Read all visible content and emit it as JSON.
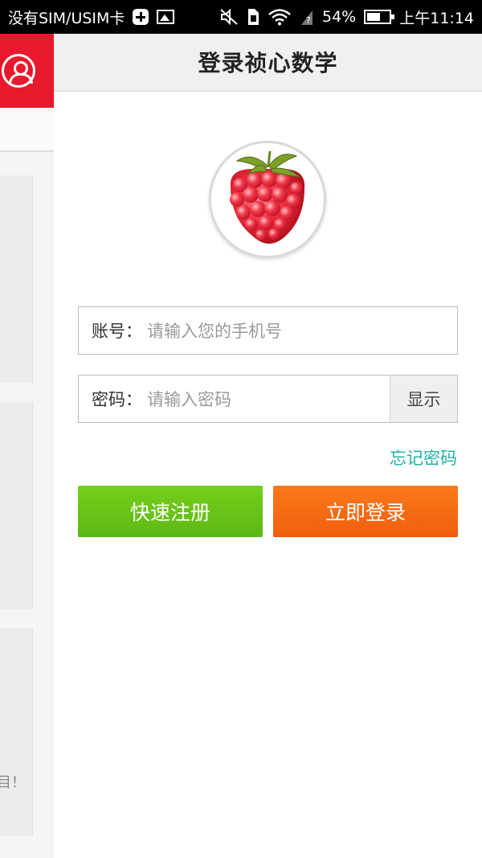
{
  "status_bar": {
    "carrier": "没有SIM/USIM卡",
    "battery": "54%",
    "time": "上午11:14"
  },
  "drawer": {
    "card_fragments": [
      "",
      "",
      "目！"
    ]
  },
  "login": {
    "title": "登录祯心数学",
    "account_label": "账号：",
    "account_placeholder": "请输入您的手机号",
    "password_label": "密码：",
    "password_placeholder": "请输入密码",
    "show_label": "显示",
    "forgot_label": "忘记密码",
    "register_label": "快速注册",
    "login_label": "立即登录"
  },
  "colors": {
    "accent_red": "#e8192d",
    "teal_link": "#21b3a3",
    "register_green": "#6cc41a",
    "login_orange": "#f56c12"
  }
}
